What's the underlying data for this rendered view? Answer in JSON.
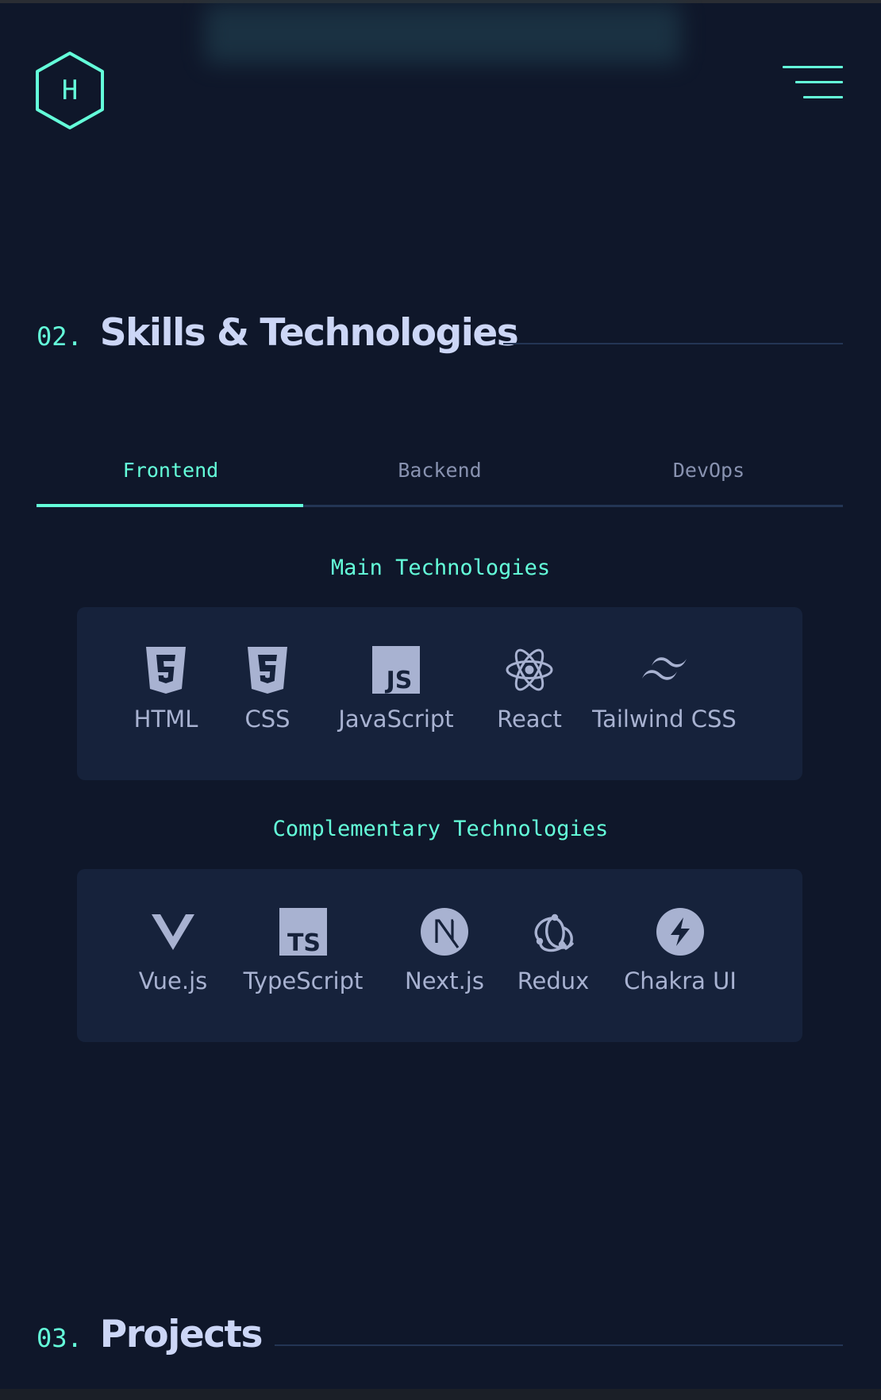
{
  "logo": {
    "letter": "H",
    "icon": "hexagon-logo-icon"
  },
  "menu": {
    "icon": "hamburger-menu-icon"
  },
  "colors": {
    "background": "#0f172a",
    "accent": "#64ffda",
    "card": "#16223b",
    "heading": "#ccd6f6",
    "muted": "#8892b0",
    "icon": "#a8b2d1"
  },
  "skills_section": {
    "number": "02.",
    "title": "Skills & Technologies",
    "tabs": [
      {
        "label": "Frontend",
        "active": true
      },
      {
        "label": "Backend",
        "active": false
      },
      {
        "label": "DevOps",
        "active": false
      }
    ],
    "main_title": "Main Technologies",
    "main": [
      {
        "label": "HTML",
        "icon": "html5-icon"
      },
      {
        "label": "CSS",
        "icon": "css3-icon"
      },
      {
        "label": "JavaScript",
        "icon": "javascript-icon"
      },
      {
        "label": "React",
        "icon": "react-icon"
      },
      {
        "label": "Tailwind CSS",
        "icon": "tailwind-icon"
      }
    ],
    "complementary_title": "Complementary Technologies",
    "complementary": [
      {
        "label": "Vue.js",
        "icon": "vue-icon"
      },
      {
        "label": "TypeScript",
        "icon": "typescript-icon"
      },
      {
        "label": "Next.js",
        "icon": "nextjs-icon"
      },
      {
        "label": "Redux",
        "icon": "redux-icon"
      },
      {
        "label": "Chakra UI",
        "icon": "chakra-icon"
      }
    ]
  },
  "projects_section": {
    "number": "03.",
    "title": "Projects"
  }
}
